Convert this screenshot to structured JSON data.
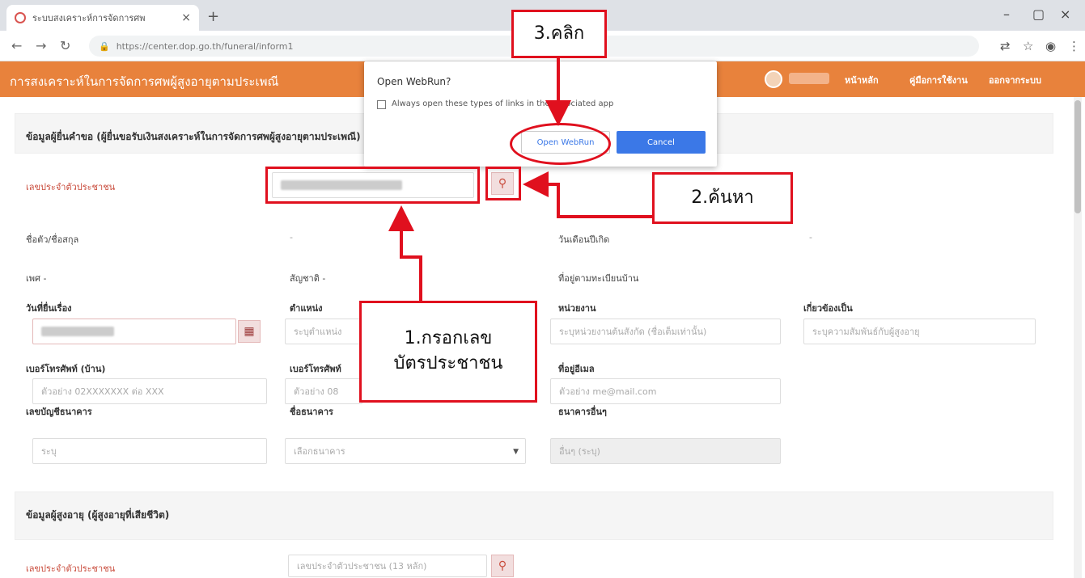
{
  "browser": {
    "tab_title": "ระบบสงเคราะห์การจัดการศพ",
    "tab_close": "×",
    "new_tab": "+",
    "url": "https://center.dop.go.th/funeral/inform1",
    "minimize": "–",
    "restore": "▢",
    "close": "×"
  },
  "app": {
    "title": "การสงเคราะห์ในการจัดการศพผู้สูงอายุตามประเพณี",
    "menu": [
      "หน้าหลัก",
      "คู่มือการใช้งาน",
      "ออกจากระบบ"
    ]
  },
  "dialog": {
    "title": "Open WebRun?",
    "checkbox_label": "Always open these types of links in the associated app",
    "open_button": "Open WebRun",
    "cancel_button": "Cancel"
  },
  "section1": {
    "title": "ข้อมูลผู้ยื่นคำขอ (ผู้ยื่นขอรับเงินสงเคราะห์ในการจัดการศพผู้สูงอายุตามประเพณี)",
    "id_label": "เลขประจำตัวประชาชน",
    "name_label": "ชื่อตัว/ชื่อสกุล",
    "name_value": "-",
    "birth_label": "วันเดือนปีเกิด",
    "birth_value": "-",
    "sex_label": "เพศ -",
    "nationality_label": "สัญชาติ -",
    "address_label": "ที่อยู่ตามทะเบียนบ้าน",
    "request_date_label": "วันที่ยื่นเรื่อง",
    "position_label": "ตำแหน่ง",
    "position_placeholder": "ระบุตำแหน่ง",
    "agency_label": "หน่วยงาน",
    "agency_placeholder": "ระบุหน่วยงานต้นสังกัด (ชื่อเต็มเท่านั้น)",
    "relation_label": "เกี่ยวข้องเป็น",
    "relation_placeholder": "ระบุความสัมพันธ์กับผู้สูงอายุ",
    "phone_home_label": "เบอร์โทรศัพท์ (บ้าน)",
    "phone_home_placeholder": "ตัวอย่าง 02XXXXXXX ต่อ XXX",
    "phone_mobile_label": "เบอร์โทรศัพท์",
    "phone_mobile_placeholder": "ตัวอย่าง 08",
    "email_label": "ที่อยู่อีเมล",
    "email_placeholder": "ตัวอย่าง me@mail.com",
    "account_label": "เลขบัญชีธนาคาร",
    "account_placeholder": "ระบุ",
    "bank_label": "ชื่อธนาคาร",
    "bank_value": "เลือกธนาคาร",
    "other_bank_label": "ธนาคารอื่นๆ",
    "other_bank_placeholder": "อื่นๆ (ระบุ)"
  },
  "section2": {
    "title": "ข้อมูลผู้สูงอายุ (ผู้สูงอายุที่เสียชีวิต)",
    "id_label": "เลขประจำตัวประชาชน",
    "id_placeholder": "เลขประจำตัวประชาชน (13 หลัก)"
  },
  "annotations": {
    "step1": "1.กรอกเลข\nบัตรประชาชน",
    "step2": "2.ค้นหา",
    "step3": "3.คลิก"
  },
  "icons": {
    "search": "search-icon",
    "calendar": "calendar-icon"
  }
}
